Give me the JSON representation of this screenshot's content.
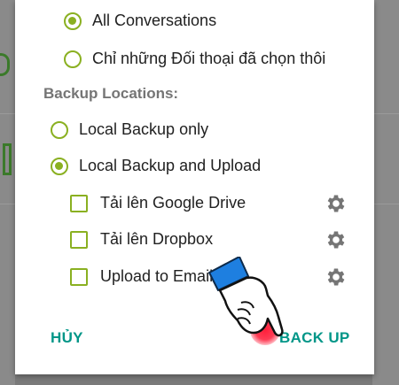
{
  "options": {
    "all_conversations": "All Conversations",
    "selected_only": "Chỉ những Đối thoại đã chọn thôi"
  },
  "backup_locations": {
    "title": "Backup Locations:",
    "local_only": "Local Backup only",
    "local_and_upload": "Local Backup and Upload"
  },
  "upload_targets": [
    {
      "label": "Tải lên Google Drive"
    },
    {
      "label": "Tải lên Dropbox"
    },
    {
      "label": "Upload to Email"
    }
  ],
  "buttons": {
    "cancel": "HỦY",
    "backup": "BACK UP"
  },
  "colors": {
    "accent": "#8ab021",
    "button": "#009688"
  }
}
